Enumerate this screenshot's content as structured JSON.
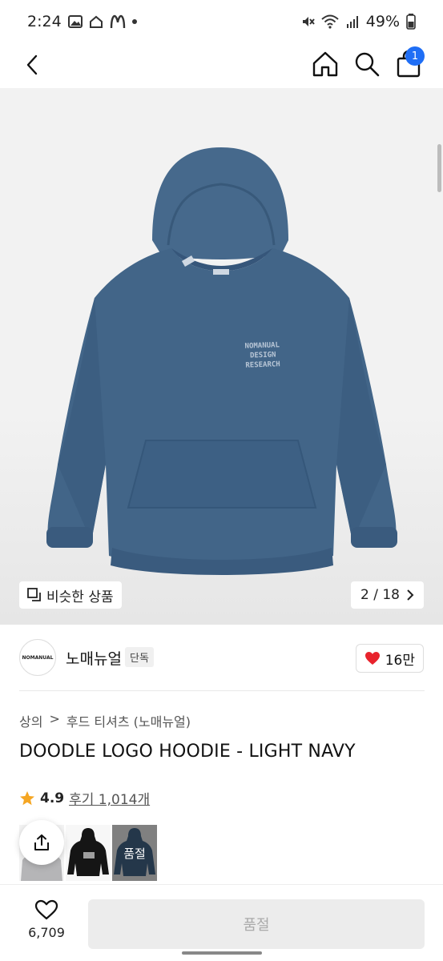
{
  "status_bar": {
    "time": "2:24",
    "battery": "49%"
  },
  "nav": {
    "cart_count": "1"
  },
  "gallery": {
    "similar_label": "비슷한 상품",
    "counter": "2 / 18",
    "print_line1": "NOMANUAL",
    "print_line2": "DESIGN",
    "print_line3": "RESEARCH"
  },
  "brand": {
    "name": "노매뉴얼",
    "tag": "단독",
    "logo_text": "NOMANUAL",
    "likes": "16만"
  },
  "breadcrumb": {
    "category": "상의",
    "separator": ">",
    "sub": "후드 티셔츠 (노매뉴얼)"
  },
  "product": {
    "title": "DOODLE LOGO HOODIE - LIGHT NAVY",
    "rating": "4.9",
    "reviews": "후기 1,014개"
  },
  "variants": {
    "soldout_label": "품절"
  },
  "bottom": {
    "wish_count": "6,709",
    "buy_label": "품절"
  },
  "colors": {
    "accent": "#1f6ef5",
    "heart": "#e8232c",
    "star": "#f5a623",
    "hoodie": "#3f6387"
  }
}
